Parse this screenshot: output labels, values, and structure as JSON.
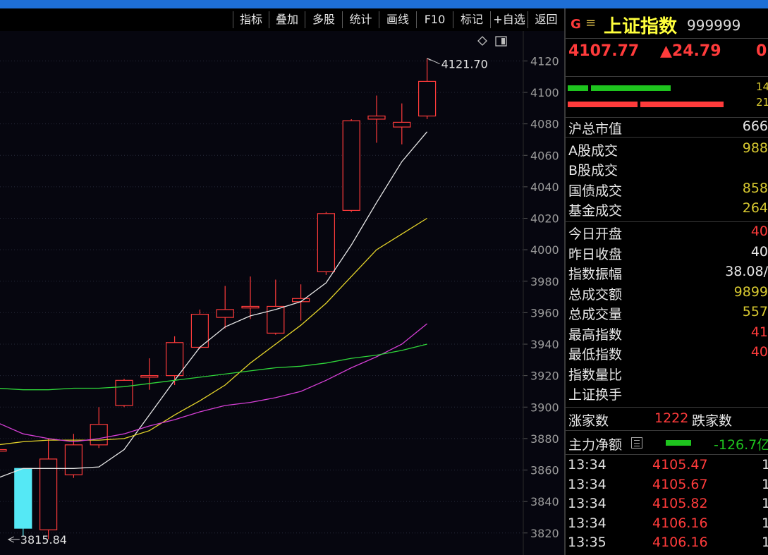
{
  "toolbar": {
    "buttons": [
      "指标",
      "叠加",
      "多股",
      "统计",
      "画线",
      "F10",
      "标记",
      "+自选",
      "返回"
    ]
  },
  "colors": {
    "up": "#ff3b3b",
    "down": "#55e8f5",
    "ma5": "#e8e8e8",
    "ma10": "#e6d52a",
    "ma20": "#d63fd6",
    "ma60": "#2fd63a",
    "background": "#06060f",
    "accent": "#1e6fd6"
  },
  "icons": {
    "diamond": "diamond-icon",
    "layout": "window-layout-icon",
    "menu": "menu-icon"
  },
  "chart_data": {
    "type": "candlestick",
    "title": "",
    "xlabel": "",
    "ylabel": "",
    "ylim": [
      3806,
      4139
    ],
    "yticks": [
      3820,
      3840,
      3860,
      3880,
      3900,
      3920,
      3940,
      3960,
      3980,
      4000,
      4020,
      4040,
      4060,
      4080,
      4100,
      4120
    ],
    "grid": "horizontal dotted",
    "candles": [
      {
        "open": 3872,
        "close": 3873,
        "high": 3873,
        "low": 3871
      },
      {
        "open": 3861,
        "close": 3823,
        "high": 3861,
        "low": 3818
      },
      {
        "open": 3822,
        "close": 3867,
        "high": 3880,
        "low": 3816
      },
      {
        "open": 3857,
        "close": 3876,
        "high": 3883,
        "low": 3855
      },
      {
        "open": 3876,
        "close": 3889,
        "high": 3900,
        "low": 3874
      },
      {
        "open": 3901,
        "close": 3917,
        "high": 3918,
        "low": 3900
      },
      {
        "open": 3919,
        "close": 3920,
        "high": 3931,
        "low": 3911
      },
      {
        "open": 3920,
        "close": 3941,
        "high": 3945,
        "low": 3914
      },
      {
        "open": 3938,
        "close": 3959,
        "high": 3962,
        "low": 3937
      },
      {
        "open": 3957,
        "close": 3962,
        "high": 3977,
        "low": 3950
      },
      {
        "open": 3963,
        "close": 3964,
        "high": 3983,
        "low": 3956
      },
      {
        "open": 3947,
        "close": 3964,
        "high": 3981,
        "low": 3946
      },
      {
        "open": 3967,
        "close": 3969,
        "high": 3978,
        "low": 3955
      },
      {
        "open": 3986,
        "close": 4023,
        "high": 4024,
        "low": 3984
      },
      {
        "open": 4025,
        "close": 4082,
        "high": 4083,
        "low": 4024
      },
      {
        "open": 4083,
        "close": 4085,
        "high": 4098,
        "low": 4068
      },
      {
        "open": 4078,
        "close": 4081,
        "high": 4093,
        "low": 4067
      },
      {
        "open": 4085,
        "close": 4107,
        "high": 4121.7,
        "low": 4083
      }
    ],
    "ma5": [
      3855,
      3861,
      3861,
      3861,
      3862,
      3873,
      3895,
      3917,
      3938,
      3951,
      3958,
      3962,
      3967,
      3979,
      4003,
      4030,
      4056,
      4075
    ],
    "ma10": [
      3876,
      3878,
      3879,
      3879,
      3879,
      3880,
      3885,
      3895,
      3904,
      3914,
      3928,
      3940,
      3952,
      3966,
      3983,
      4000,
      4010,
      4020
    ],
    "ma20": [
      3890,
      3883,
      3880,
      3878,
      3880,
      3883,
      3888,
      3892,
      3897,
      3901,
      3903,
      3906,
      3910,
      3917,
      3925,
      3932,
      3940,
      3953
    ],
    "ma60": [
      3912,
      3911,
      3911,
      3912,
      3912,
      3913,
      3915,
      3917,
      3919,
      3921,
      3923,
      3925,
      3926,
      3928,
      3931,
      3933,
      3936,
      3940
    ],
    "annotations": {
      "high_label": "4121.70",
      "low_label": "3815.84"
    }
  },
  "panel": {
    "title_code": "G",
    "name": "上证指数",
    "code": "999999",
    "price": "4107.77",
    "change": "▲24.79",
    "change_pct_partial": "0",
    "bar1_num": "14",
    "bar2_num": "21",
    "bar1_fraction": 0.62,
    "bar2_fraction": 0.78,
    "rows": [
      {
        "label": "沪总市值",
        "value": "666",
        "color": "#e8e8e8"
      },
      {
        "label": "A股成交",
        "value": "988",
        "color": "#d7c830"
      },
      {
        "label": "B股成交",
        "value": "",
        "color": "#d7c830"
      },
      {
        "label": "国债成交",
        "value": "858",
        "color": "#d7c830"
      },
      {
        "label": "基金成交",
        "value": "264",
        "color": "#d7c830"
      },
      {
        "label": "今日开盘",
        "value": "40",
        "color": "#ff3b3b"
      },
      {
        "label": "昨日收盘",
        "value": "40",
        "color": "#e8e8e8"
      },
      {
        "label": "指数振幅",
        "value": "38.08/",
        "color": "#e8e8e8"
      },
      {
        "label": "总成交额",
        "value": "9899",
        "color": "#d7c830"
      },
      {
        "label": "总成交量",
        "value": "557",
        "color": "#d7c830"
      },
      {
        "label": "最高指数",
        "value": "41",
        "color": "#ff3b3b"
      },
      {
        "label": "最低指数",
        "value": "40",
        "color": "#ff3b3b"
      },
      {
        "label": "指数量比",
        "value": "",
        "color": "#e8e8e8"
      },
      {
        "label": "上证换手",
        "value": "",
        "color": "#e8e8e8"
      }
    ],
    "breadth": {
      "up_label": "涨家数",
      "up_value": "1222",
      "down_label": "跌家数"
    },
    "mainforce": {
      "label": "主力净额",
      "value": "-126.7亿"
    },
    "ticks": [
      {
        "time": "13:34",
        "price": "4105.47",
        "vol": "1"
      },
      {
        "time": "13:34",
        "price": "4105.67",
        "vol": "1"
      },
      {
        "time": "13:34",
        "price": "4105.82",
        "vol": "1"
      },
      {
        "time": "13:34",
        "price": "4106.16",
        "vol": "1"
      },
      {
        "time": "13:35",
        "price": "4106.16",
        "vol": "1"
      }
    ]
  }
}
